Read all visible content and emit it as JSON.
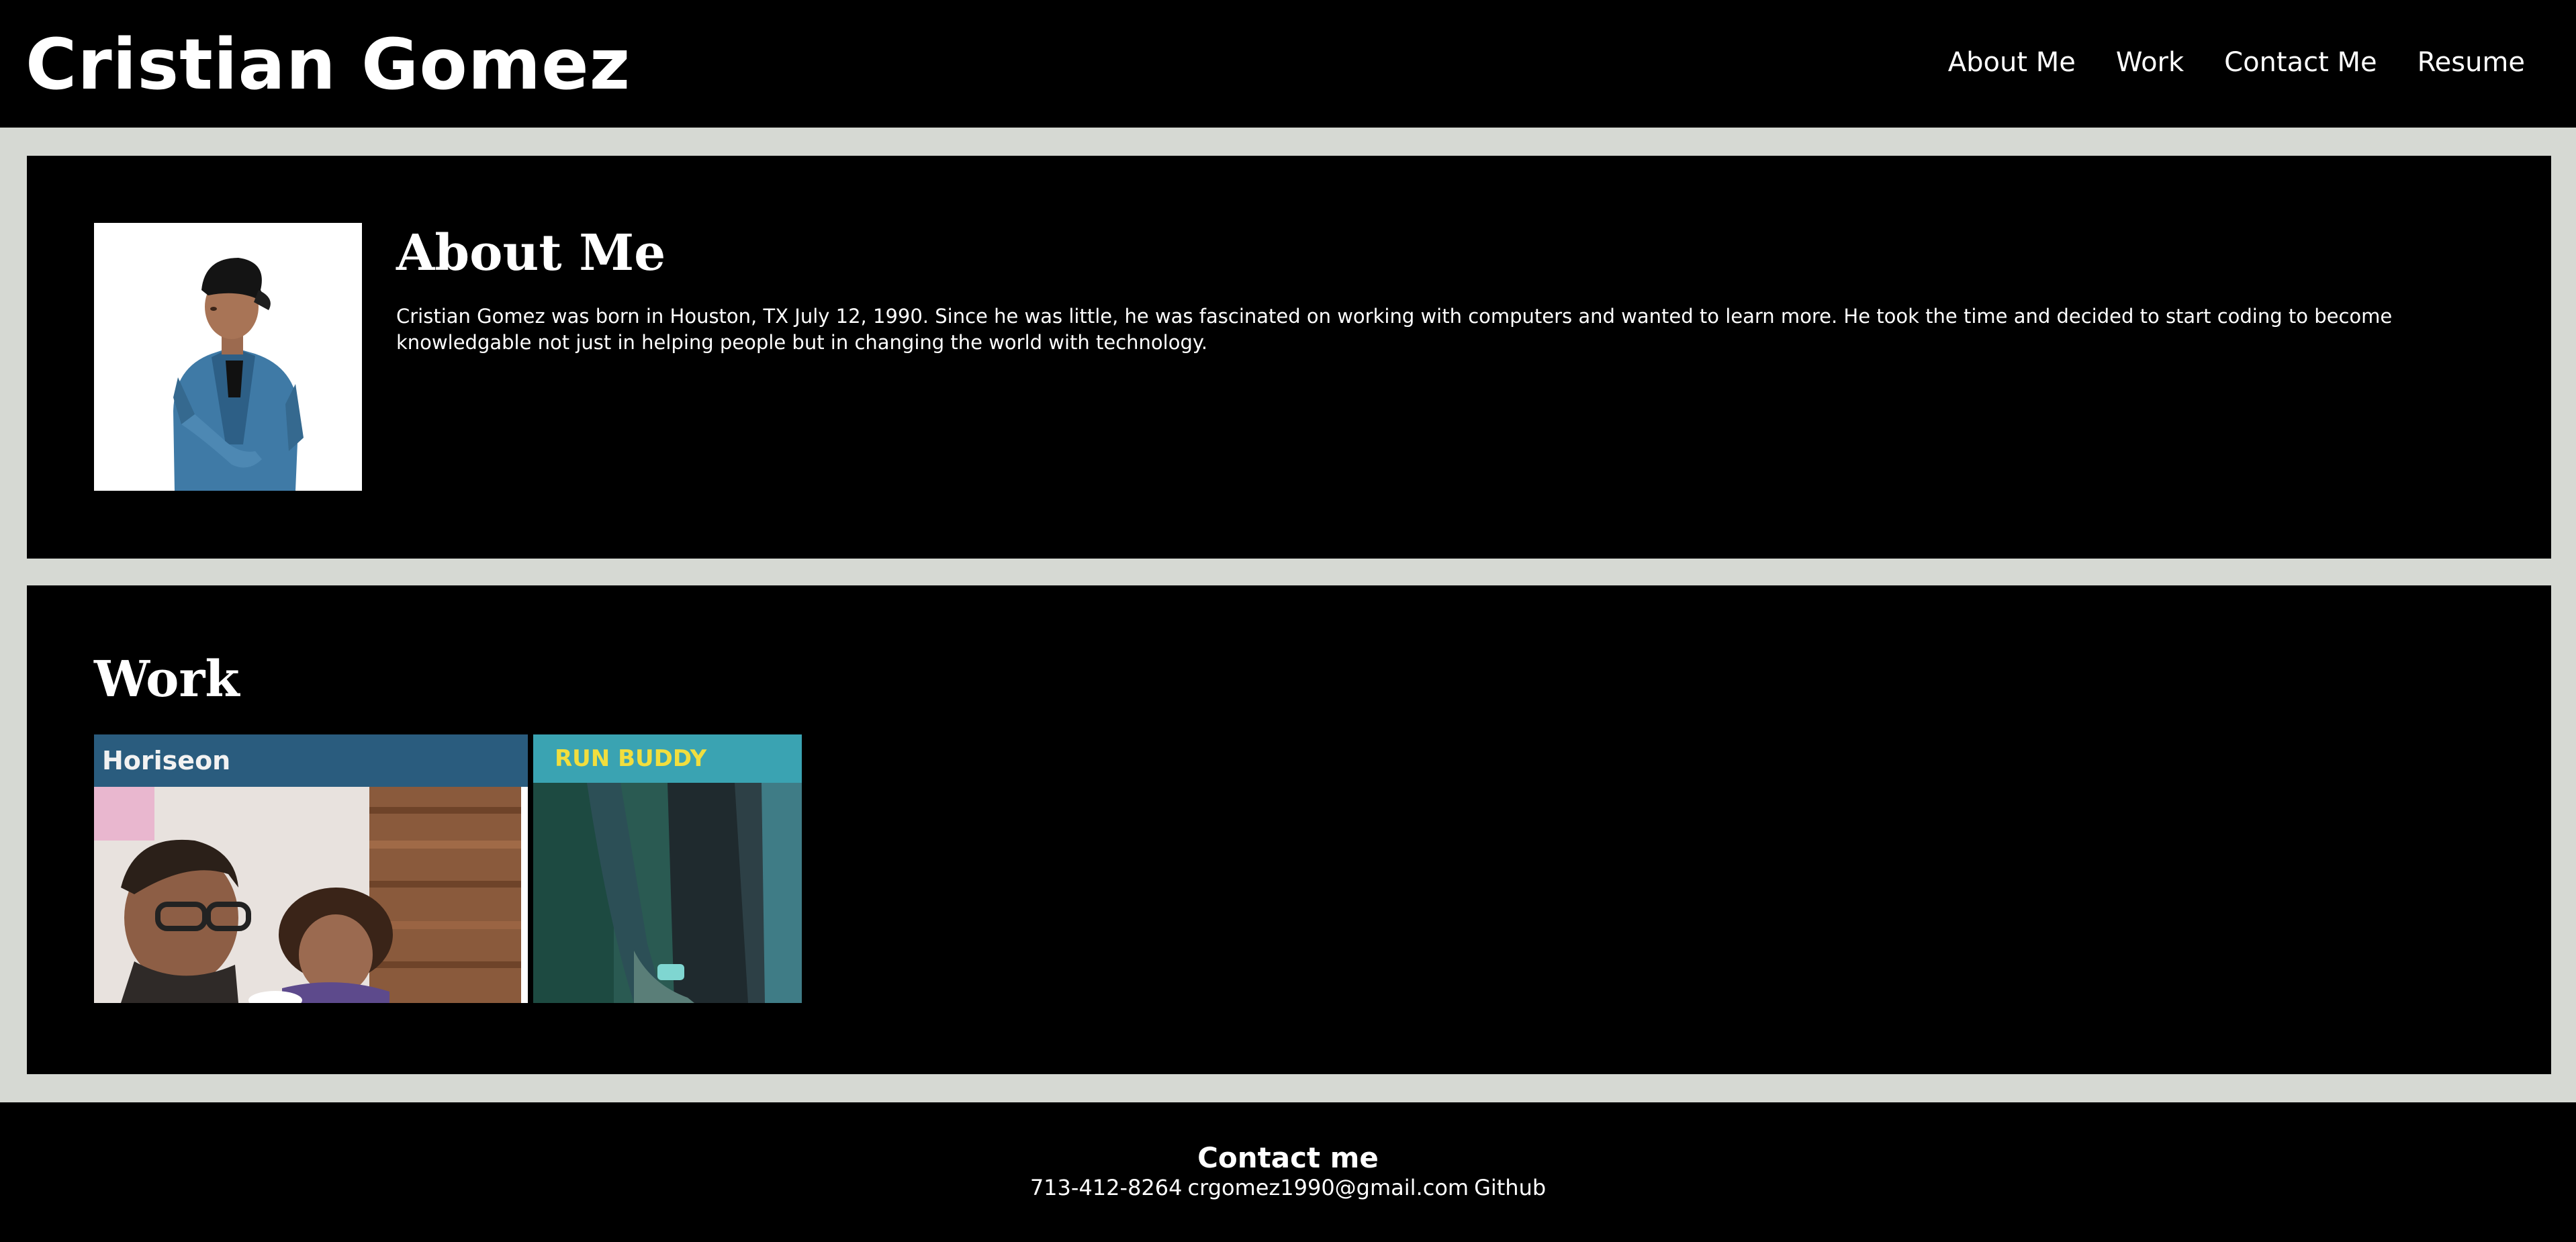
{
  "header": {
    "title": "Cristian Gomez",
    "nav": [
      {
        "label": "About Me"
      },
      {
        "label": "Work"
      },
      {
        "label": "Contact Me"
      },
      {
        "label": "Resume"
      }
    ]
  },
  "about": {
    "title": "About Me",
    "text": "Cristian Gomez was born in Houston, TX July 12, 1990. Since he was little, he was fascinated on working with computers and wanted to learn more. He took the time and decided to start coding to become knowledgable not just in helping people but in changing the world with technology."
  },
  "work": {
    "title": "Work",
    "projects": [
      {
        "banner": "Horiseon"
      },
      {
        "banner": "RUN BUDDY"
      }
    ]
  },
  "footer": {
    "title": "Contact me",
    "phone": "713-412-8264",
    "email": "crgomez1990@gmail.com",
    "github": "Github"
  },
  "colors": {
    "page_background": "#d6d9d3",
    "panel_background": "#000000",
    "text": "#ffffff",
    "horiseon_banner": "#2a5c7e",
    "runbuddy_banner": "#3aa3b2",
    "runbuddy_text": "#f1de3e"
  }
}
